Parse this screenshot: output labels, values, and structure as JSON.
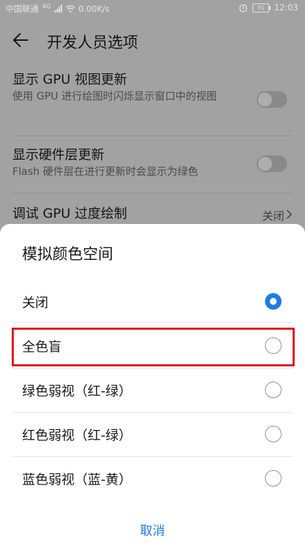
{
  "status_bar": {
    "carrier": "中国联通",
    "network_type": "4G",
    "speed": "0.00K/s",
    "battery": "91",
    "time": "12:03"
  },
  "app_bar": {
    "title": "开发人员选项"
  },
  "settings": [
    {
      "title": "显示 GPU 视图更新",
      "subtitle": "使用 GPU 进行绘图时闪烁显示窗口中的视图"
    },
    {
      "title": "显示硬件层更新",
      "subtitle": "Flash 硬件层在进行更新时会显示为绿色"
    },
    {
      "title": "调试 GPU 过度绘制",
      "value": "关闭"
    }
  ],
  "dialog": {
    "title": "模拟颜色空间",
    "options": [
      {
        "label": "关闭",
        "selected": true
      },
      {
        "label": "全色盲",
        "selected": false
      },
      {
        "label": "绿色弱视（红-绿）",
        "selected": false
      },
      {
        "label": "红色弱视（红-绿）",
        "selected": false
      },
      {
        "label": "蓝色弱视（蓝-黄）",
        "selected": false
      }
    ],
    "cancel_label": "取消"
  },
  "colors": {
    "accent": "#1e7be6",
    "highlight_border": "#e00b12"
  }
}
